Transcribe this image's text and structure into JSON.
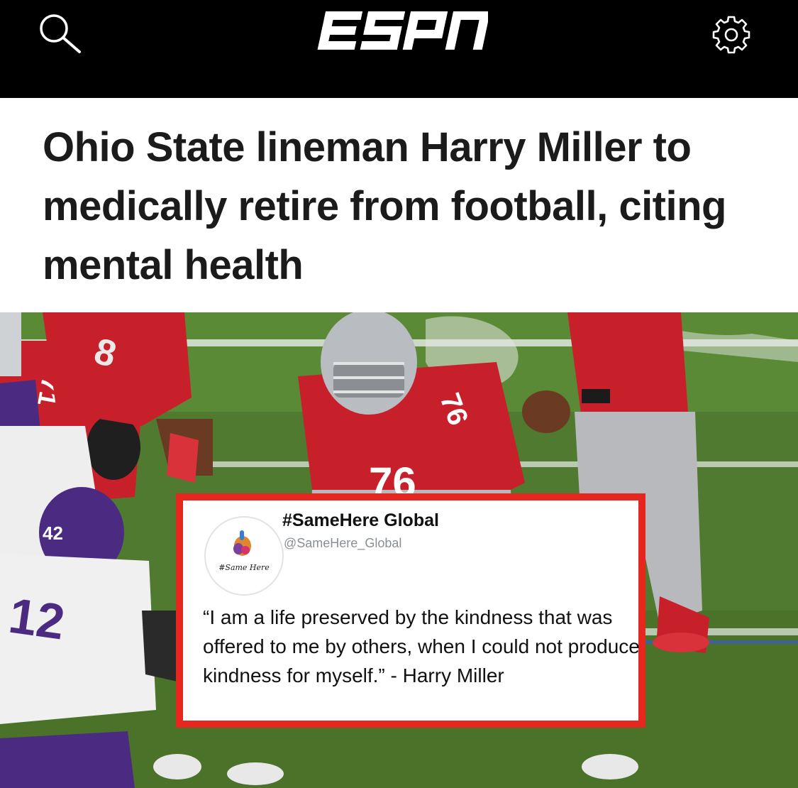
{
  "header": {
    "logo_text": "ESPN",
    "search_icon": "search-icon",
    "settings_icon": "gear-icon",
    "background": "#000000"
  },
  "article": {
    "headline": "Ohio State lineman Harry Miller to medically retire from football, citing mental health"
  },
  "hero": {
    "description_icon": "football-game-photo",
    "jersey_numbers": [
      "71",
      "8",
      "76",
      "42",
      "12"
    ],
    "colors": {
      "turf": "#4f7a2f",
      "ohio_red": "#c8202b",
      "ohio_gray": "#b7b9bd",
      "northwestern_purple": "#4b2b82"
    }
  },
  "tweet": {
    "display_name": "#SameHere Global",
    "handle": "@SameHere_Global",
    "avatar_caption": "#Same Here",
    "quote": "“I am a life preserved by the kindness that was offered to me by others, when I could not produce kindness for myself.” - Harry Miller",
    "border_color": "#e5271f"
  }
}
